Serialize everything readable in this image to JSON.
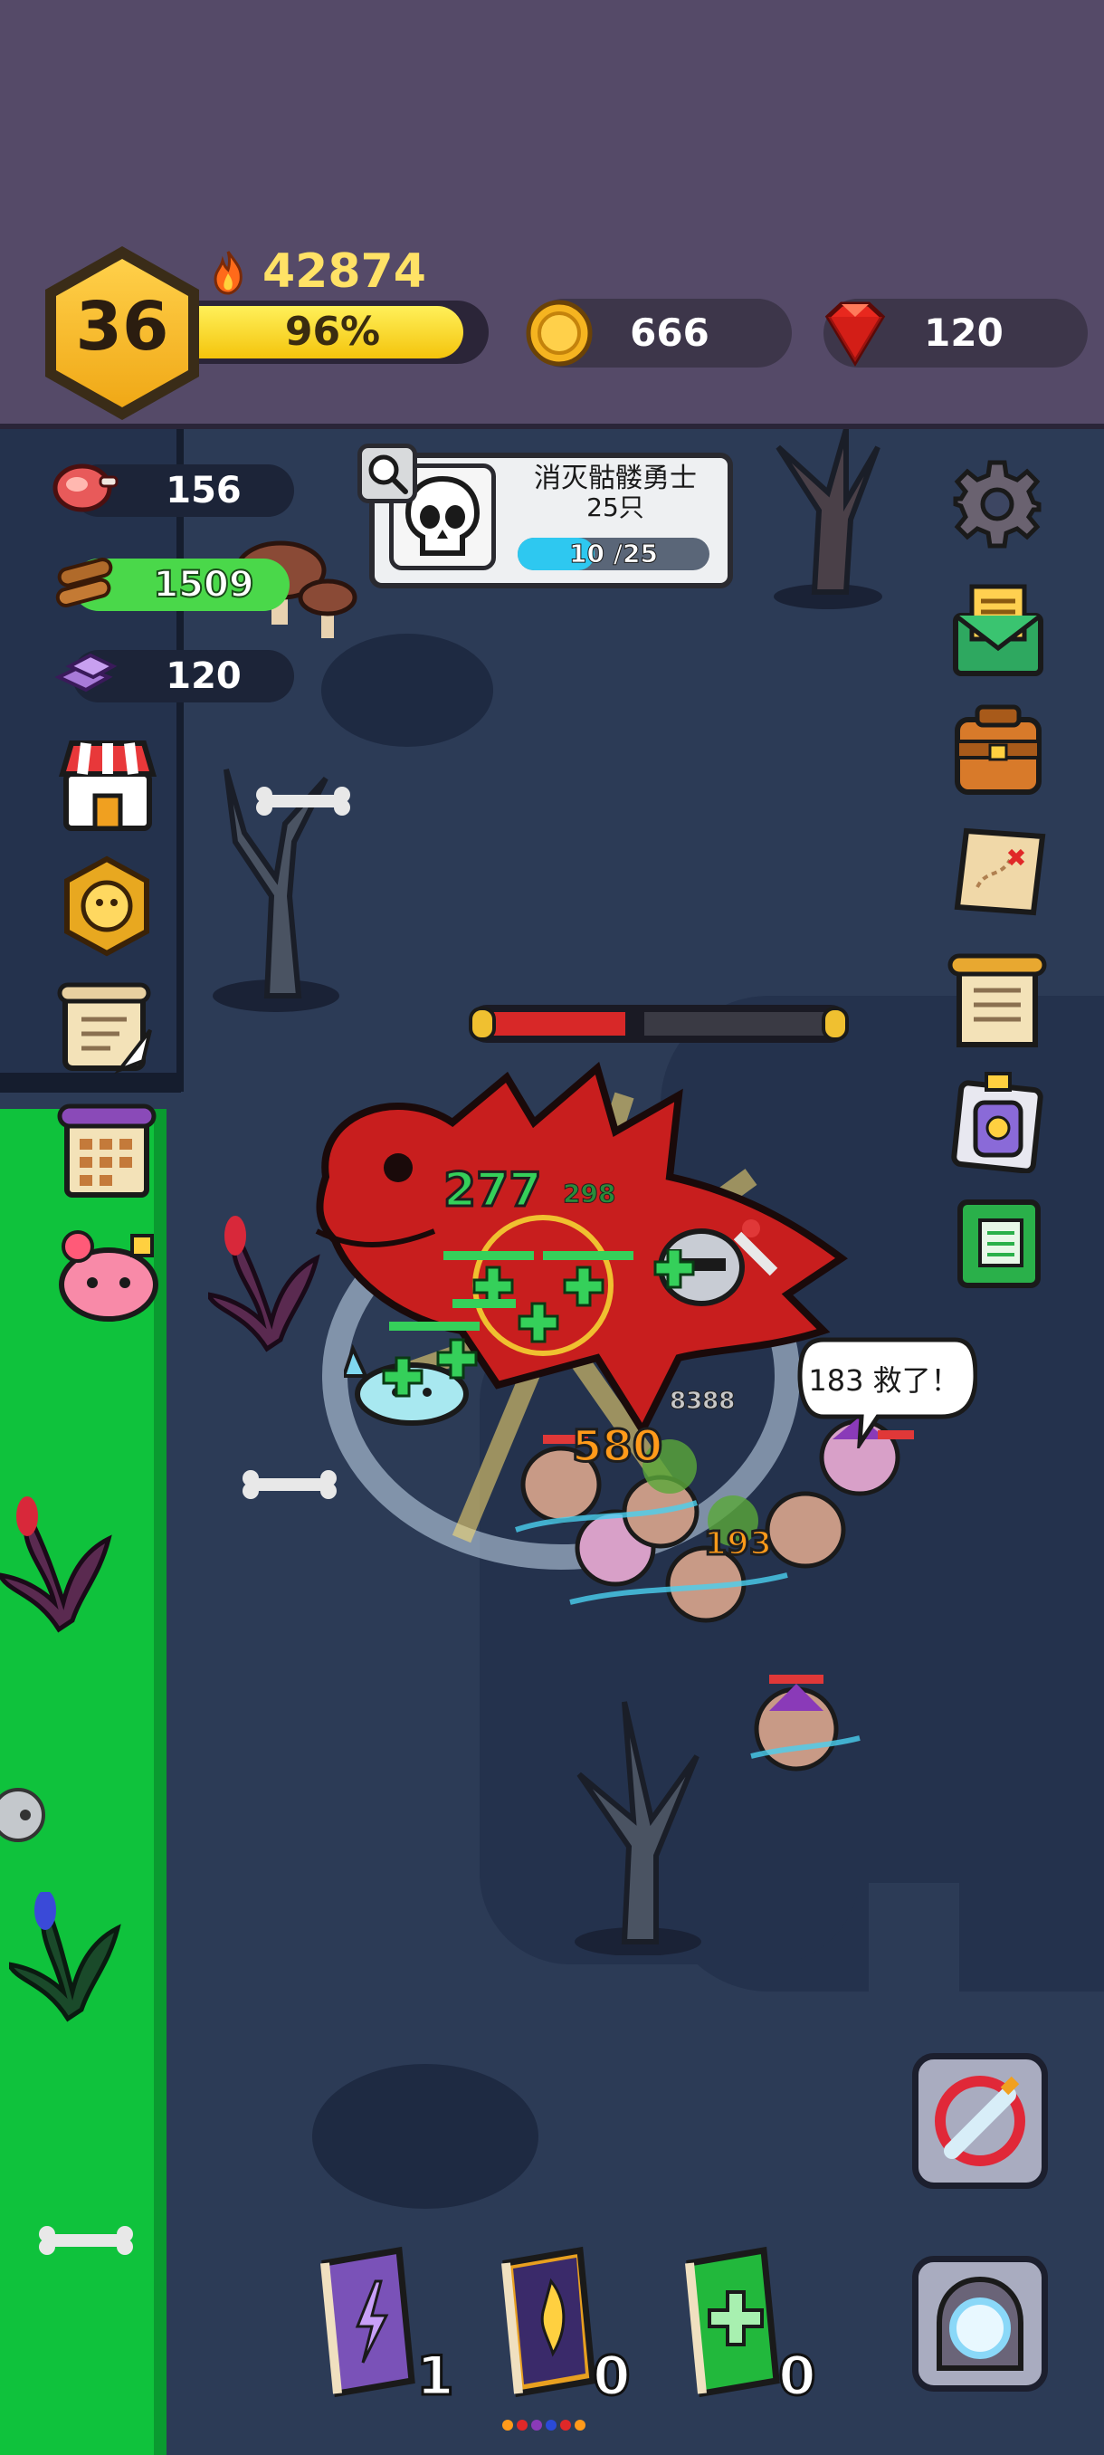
{
  "hud": {
    "level": "36",
    "xp_percent_label": "96%",
    "xp_fraction": 0.96,
    "power": "42874",
    "gold": "666",
    "gems": "120"
  },
  "resources": {
    "meat": "156",
    "wood": "1509",
    "ore": "120"
  },
  "quest": {
    "title": "消灭骷髅勇士",
    "subtitle": "25只",
    "progress_label": "10 /25",
    "progress_fraction": 0.4
  },
  "left_menu": [
    "shop-icon",
    "medal-icon",
    "scroll-quill-icon",
    "calendar-scroll-icon",
    "pink-pet-icon"
  ],
  "right_menu": [
    "gear-icon",
    "mail-icon",
    "backpack-icon",
    "treasure-map-icon",
    "notice-scroll-icon",
    "potion-card-icon",
    "green-book-icon"
  ],
  "battle": {
    "boss_hp_fraction": 0.4,
    "damage_numbers": [
      "277",
      "298",
      "580",
      "8388",
      "193"
    ],
    "speech": "183 救了！"
  },
  "skill_books": [
    {
      "name": "lightning-book",
      "count": "1",
      "color": "#7a52b8"
    },
    {
      "name": "flame-book",
      "count": "0",
      "color": "#e8a020"
    },
    {
      "name": "heal-book",
      "count": "0",
      "color": "#22b83c"
    }
  ],
  "colors": {
    "hud_bg": "#554a68",
    "map_bg": "#2c3b56",
    "grass": "#0fc23c",
    "xp_bar": "#f4c40c",
    "boss_red": "#c81e1e",
    "heal_green": "#35d05a",
    "damage_orange": "#ff9a1a"
  }
}
